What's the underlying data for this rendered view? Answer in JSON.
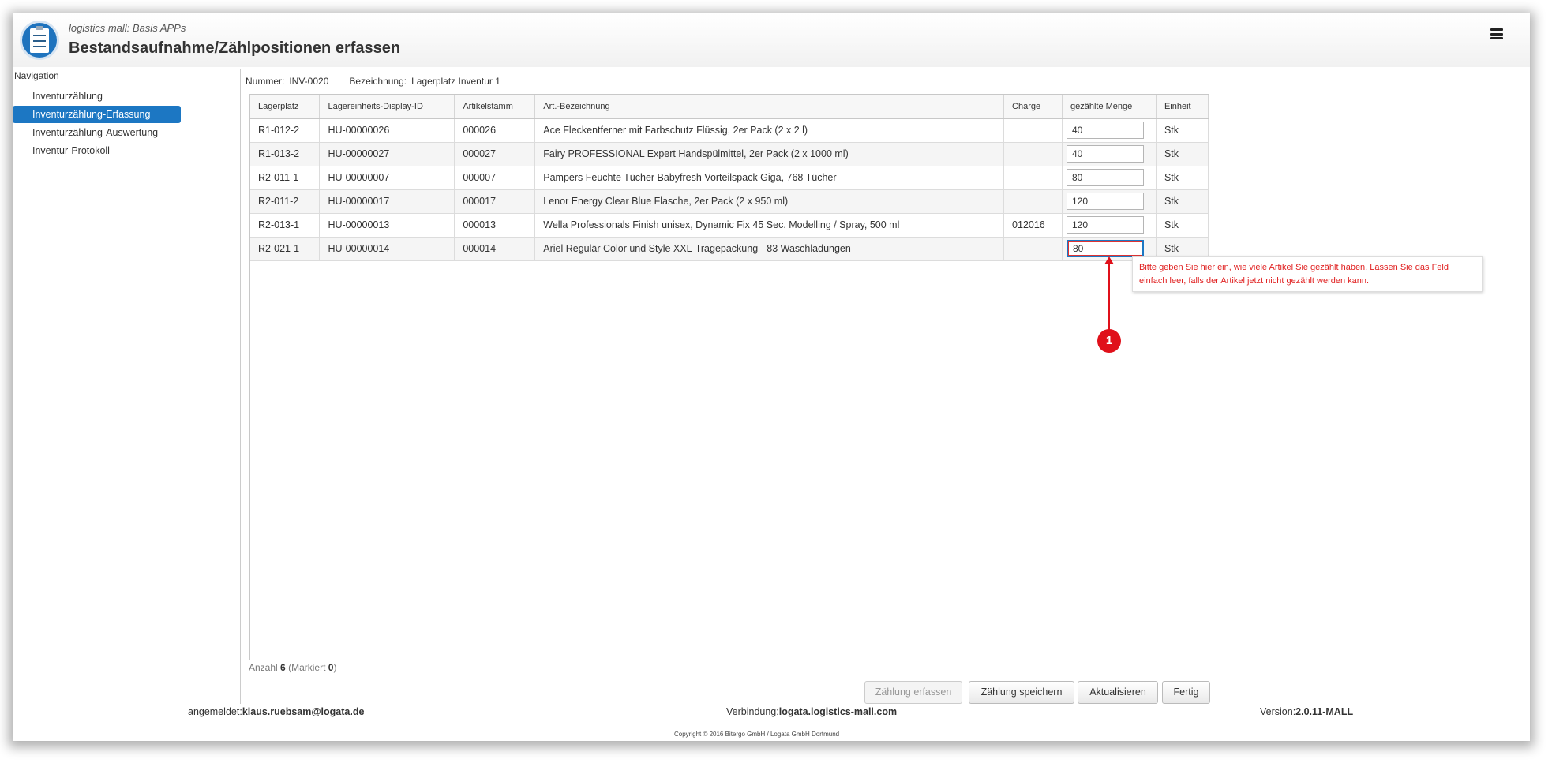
{
  "header": {
    "subtitle": "logistics mall: Basis APPs",
    "title": "Bestandsaufnahme/Zählpositionen erfassen"
  },
  "nav": {
    "title": "Navigation",
    "items": [
      {
        "label": "Inventurzählung"
      },
      {
        "label": "Inventurzählung-Erfassung"
      },
      {
        "label": "Inventurzählung-Auswertung"
      },
      {
        "label": "Inventur-Protokoll"
      }
    ]
  },
  "meta": {
    "nummer_label": "Nummer:",
    "nummer_value": "INV-0020",
    "bezeichnung_label": "Bezeichnung:",
    "bezeichnung_value": "Lagerplatz Inventur 1"
  },
  "table": {
    "columns": [
      "Lagerplatz",
      "Lagereinheits-Display-ID",
      "Artikelstamm",
      "Art.-Bezeichnung",
      "Charge",
      "gezählte Menge",
      "Einheit"
    ],
    "rows": [
      {
        "lagerplatz": "R1-012-2",
        "lhid": "HU-00000026",
        "artikel": "000026",
        "bezeichnung": "Ace Fleckentferner mit Farbschutz Flüssig, 2er Pack (2 x 2 l)",
        "charge": "",
        "menge": "40",
        "einheit": "Stk"
      },
      {
        "lagerplatz": "R1-013-2",
        "lhid": "HU-00000027",
        "artikel": "000027",
        "bezeichnung": "Fairy PROFESSIONAL Expert Handspülmittel, 2er Pack (2 x 1000 ml)",
        "charge": "",
        "menge": "40",
        "einheit": "Stk"
      },
      {
        "lagerplatz": "R2-011-1",
        "lhid": "HU-00000007",
        "artikel": "000007",
        "bezeichnung": "Pampers Feuchte Tücher Babyfresh Vorteilspack Giga, 768 Tücher",
        "charge": "",
        "menge": "80",
        "einheit": "Stk"
      },
      {
        "lagerplatz": "R2-011-2",
        "lhid": "HU-00000017",
        "artikel": "000017",
        "bezeichnung": "Lenor Energy Clear Blue Flasche, 2er Pack (2 x 950 ml)",
        "charge": "",
        "menge": "120",
        "einheit": "Stk"
      },
      {
        "lagerplatz": "R2-013-1",
        "lhid": "HU-00000013",
        "artikel": "000013",
        "bezeichnung": "Wella Professionals Finish unisex, Dynamic Fix 45 Sec. Modelling / Spray, 500 ml",
        "charge": "012016",
        "menge": "120",
        "einheit": "Stk"
      },
      {
        "lagerplatz": "R2-021-1",
        "lhid": "HU-00000014",
        "artikel": "000014",
        "bezeichnung": "Ariel Regulär Color und Style XXL-Tragepackung - 83 Waschladungen",
        "charge": "",
        "menge": "80",
        "einheit": "Stk"
      }
    ]
  },
  "tooltip": {
    "text": "Bitte geben Sie hier ein, wie viele Artikel Sie gezählt haben. Lassen Sie das Feld einfach leer, falls der Artikel jetzt nicht gezählt werden kann."
  },
  "callout": {
    "number": "1"
  },
  "count": {
    "prefix": "Anzahl",
    "total": "6",
    "marked_prefix": "(Markiert",
    "marked": "0",
    "suffix": ")"
  },
  "buttons": {
    "zaehlung_erfassen": "Zählung erfassen",
    "zaehlung_speichern": "Zählung speichern",
    "aktualisieren": "Aktualisieren",
    "fertig": "Fertig"
  },
  "footer": {
    "user_label": "angemeldet:",
    "user_value": "klaus.ruebsam@logata.de",
    "conn_label": "Verbindung:",
    "conn_value": "logata.logistics-mall.com",
    "version_label": "Version:",
    "version_value": "2.0.11-MALL",
    "copyright": "Copyright © 2016 Bitergo GmbH / Logata GmbH Dortmund"
  },
  "colors": {
    "accent": "#1c77c3",
    "callout": "#e0101a",
    "error_text": "#e02020"
  }
}
